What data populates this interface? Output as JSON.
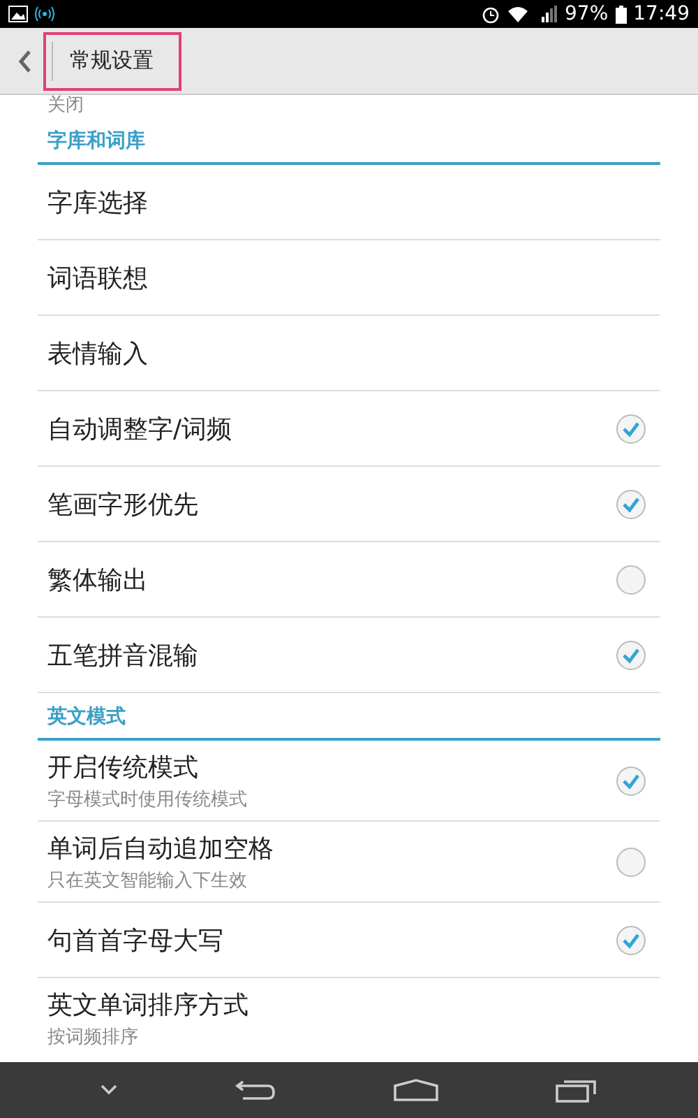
{
  "status_bar": {
    "battery": "97%",
    "time": "17:49"
  },
  "app_bar": {
    "title": "常规设置",
    "highlighted": true
  },
  "previous_summary": "关闭",
  "sections": [
    {
      "title": "字库和词库",
      "items": [
        {
          "kind": "plain",
          "label": "字库选择"
        },
        {
          "kind": "plain",
          "label": "词语联想"
        },
        {
          "kind": "plain",
          "label": "表情输入"
        },
        {
          "kind": "check",
          "label": "自动调整字/词频",
          "checked": true
        },
        {
          "kind": "check",
          "label": "笔画字形优先",
          "checked": true
        },
        {
          "kind": "check",
          "label": "繁体输出",
          "checked": false
        },
        {
          "kind": "check",
          "label": "五笔拼音混输",
          "checked": true
        }
      ]
    },
    {
      "title": "英文模式",
      "items": [
        {
          "kind": "check",
          "label": "开启传统模式",
          "summary": "字母模式时使用传统模式",
          "checked": true
        },
        {
          "kind": "check",
          "label": "单词后自动追加空格",
          "summary": "只在英文智能输入下生效",
          "checked": false
        },
        {
          "kind": "check",
          "label": "句首首字母大写",
          "checked": true
        },
        {
          "kind": "plain",
          "label": "英文单词排序方式",
          "summary": "按词频排序"
        }
      ]
    }
  ]
}
